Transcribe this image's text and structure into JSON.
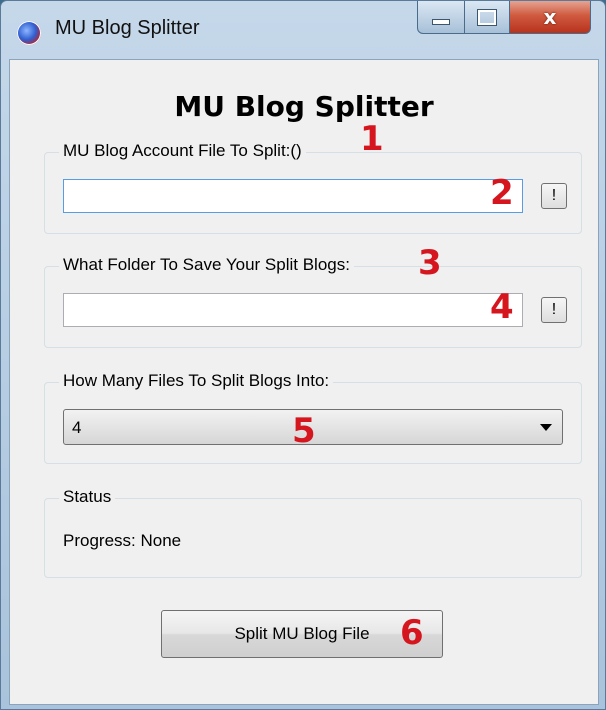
{
  "window": {
    "title": "MU Blog Splitter",
    "close_glyph": "x"
  },
  "heading": "MU Blog Splitter",
  "account_group": {
    "label": "MU Blog Account File To Split:()",
    "value": "",
    "browse_label": "!"
  },
  "folder_group": {
    "label": "What Folder To Save Your Split Blogs:",
    "value": "",
    "browse_label": "!"
  },
  "split_group": {
    "label": "How Many Files To Split Blogs Into:",
    "selected": "4"
  },
  "status_group": {
    "label": "Status",
    "progress_text": "Progress: None"
  },
  "split_button": {
    "label": "Split MU Blog File"
  },
  "annotations": [
    "1",
    "2",
    "3",
    "4",
    "5",
    "6"
  ],
  "colors": {
    "annotation_red": "#d5161f",
    "titlebar_blue": "#b7cde3",
    "close_red": "#c8452c"
  },
  "icons": {
    "app": "app-logo-icon",
    "minimize": "minimize-icon",
    "maximize": "maximize-icon",
    "close": "close-icon",
    "dropdown": "chevron-down-icon"
  }
}
